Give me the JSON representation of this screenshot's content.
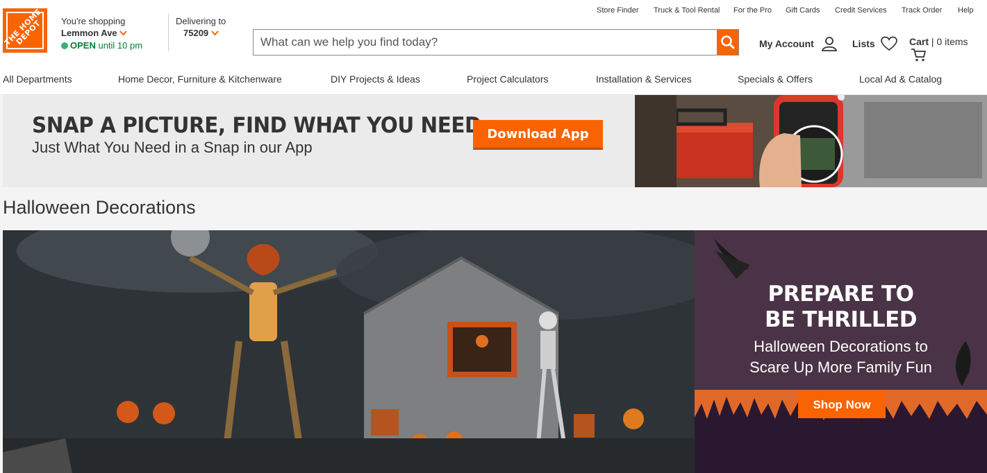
{
  "brand": {
    "logo_text": "THE HOME DEPOT",
    "accent_color": "#f96302"
  },
  "store": {
    "line1": "You're shopping",
    "store_name": "Lemmon Ave",
    "open_label": "OPEN",
    "hours": "until 10 pm"
  },
  "delivery": {
    "label": "Delivering to",
    "zip": "75209"
  },
  "utility_links": [
    "Store Finder",
    "Truck & Tool Rental",
    "For the Pro",
    "Gift Cards",
    "Credit Services",
    "Track Order",
    "Help"
  ],
  "search": {
    "placeholder": "What can we help you find today?",
    "value": ""
  },
  "header_links": {
    "account": "My Account",
    "lists": "Lists",
    "cart": "Cart",
    "cart_sep": "|",
    "cart_count": "0 items"
  },
  "nav": [
    "All Departments",
    "Home Decor, Furniture & Kitchenware",
    "DIY Projects & Ideas",
    "Project Calculators",
    "Installation & Services",
    "Specials & Offers",
    "Local Ad & Catalog"
  ],
  "promo": {
    "title": "SNAP A PICTURE, FIND WHAT YOU NEED",
    "subtitle": "Just What You Need in a Snap in our App",
    "button": "Download App"
  },
  "section": {
    "title": "Halloween Decorations"
  },
  "hero_side": {
    "title_line1": "PREPARE TO",
    "title_line2": "BE THRILLED",
    "sub_line1": "Halloween Decorations to",
    "sub_line2": "Scare Up More Family Fun",
    "button": "Shop Now"
  }
}
